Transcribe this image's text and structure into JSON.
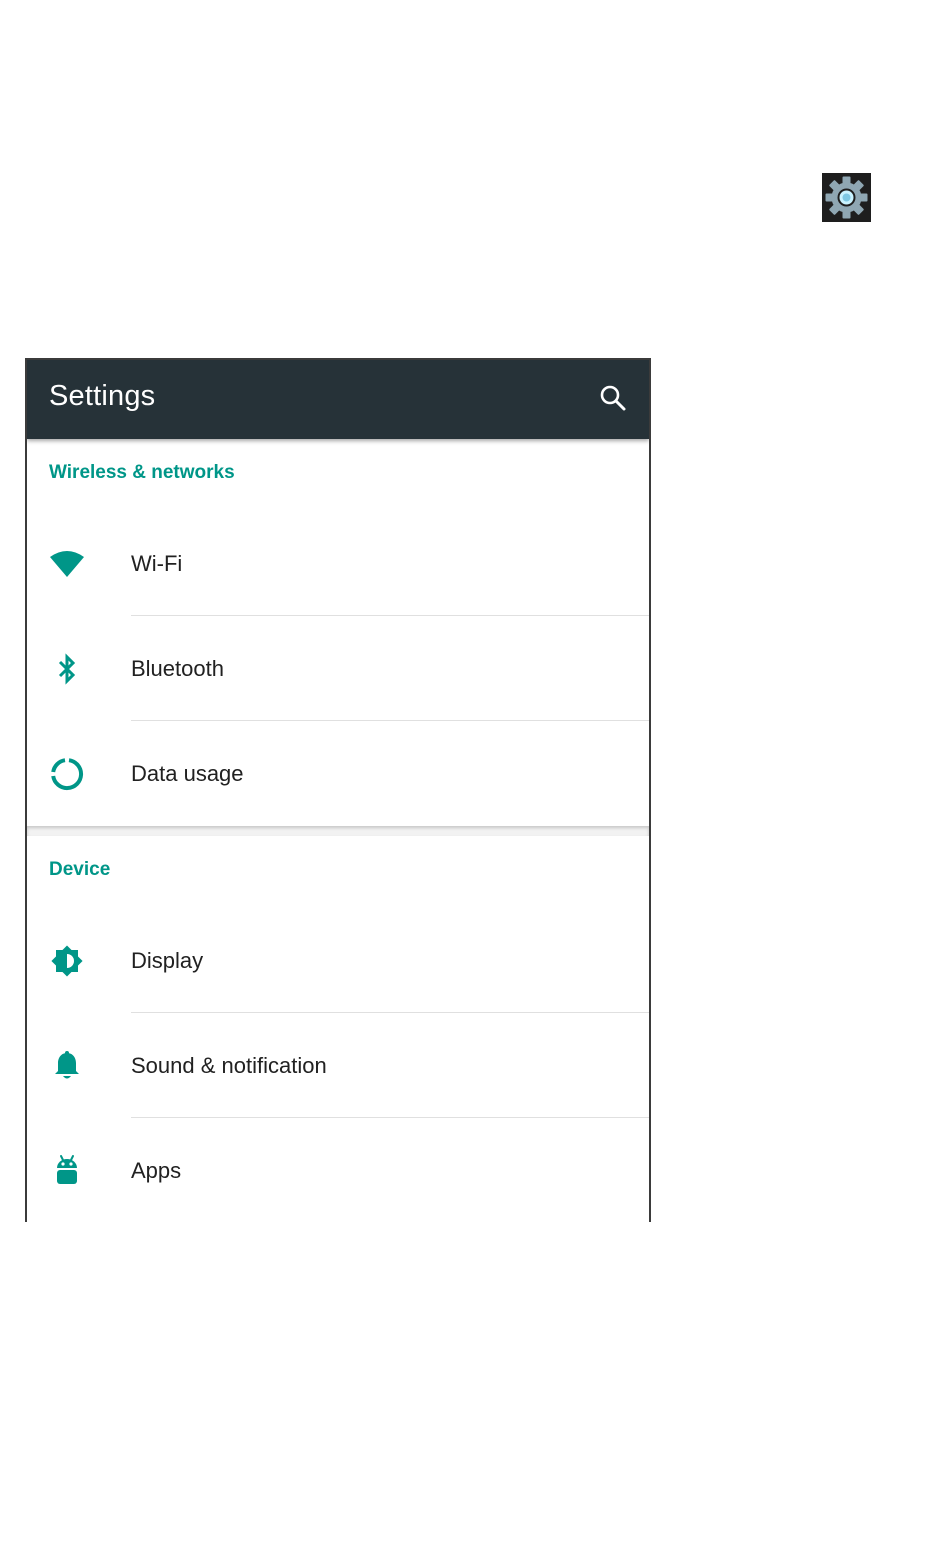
{
  "launcher": {
    "icon": "settings-gear-icon",
    "icon_color": "#7ec8e3"
  },
  "toolbar": {
    "title": "Settings",
    "search_icon": "search-icon",
    "background": "#263238"
  },
  "accent_color": "#009688",
  "sections": [
    {
      "title": "Wireless & networks",
      "items": [
        {
          "label": "Wi-Fi",
          "icon": "wifi-icon"
        },
        {
          "label": "Bluetooth",
          "icon": "bluetooth-icon"
        },
        {
          "label": "Data usage",
          "icon": "data-usage-icon"
        }
      ]
    },
    {
      "title": "Device",
      "items": [
        {
          "label": "Display",
          "icon": "brightness-icon"
        },
        {
          "label": "Sound & notification",
          "icon": "bell-icon"
        },
        {
          "label": "Apps",
          "icon": "android-icon"
        }
      ]
    }
  ]
}
